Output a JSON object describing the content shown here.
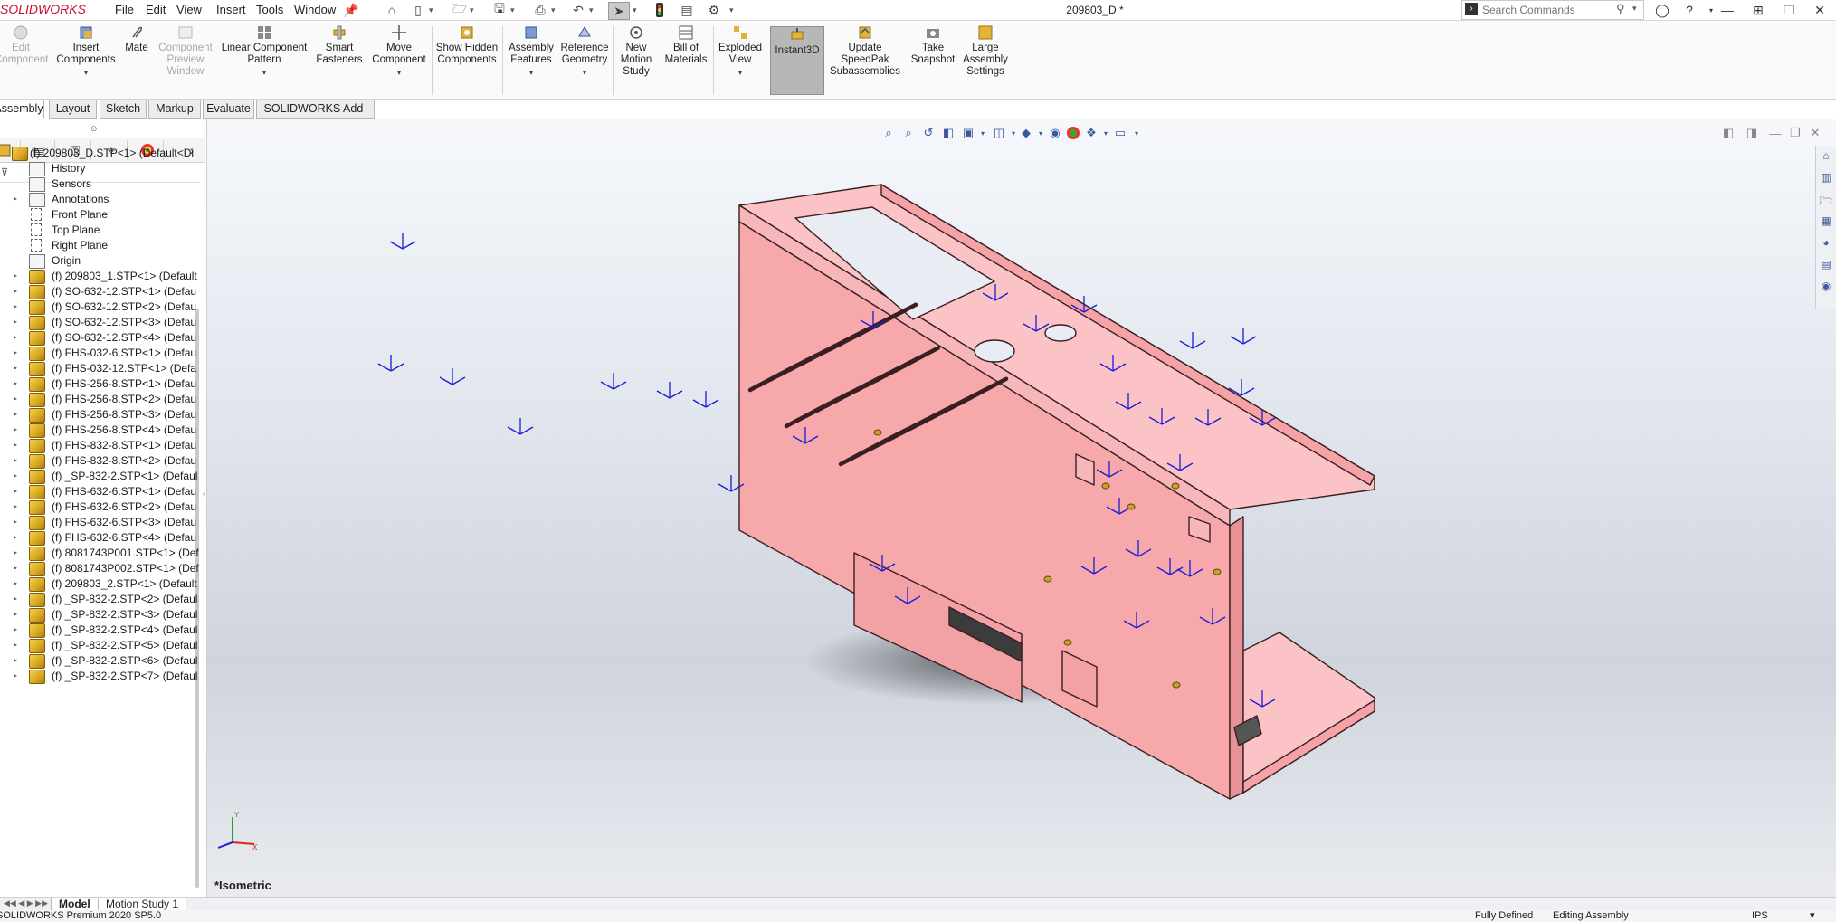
{
  "titlebar": {
    "logo_brand": "3S",
    "logo_text": "SOLIDWORKS",
    "menus": [
      "File",
      "Edit",
      "View",
      "Insert",
      "Tools",
      "Window"
    ],
    "document_title": "209803_D *",
    "search_placeholder": "Search Commands"
  },
  "toolbar": {
    "edit_component": "Edit Component",
    "insert_components": "Insert Components",
    "mate": "Mate",
    "component_preview": "Component Preview Window",
    "linear_pattern": "Linear Component Pattern",
    "smart_fasteners": "Smart Fasteners",
    "move_component": "Move Component",
    "show_hidden": "Show Hidden Components",
    "assembly_features": "Assembly Features",
    "reference_geometry": "Reference Geometry",
    "new_motion_study": "New Motion Study",
    "bill_of_materials": "Bill of Materials",
    "exploded_view": "Exploded View",
    "instant3d": "Instant3D",
    "update_speedpak": "Update SpeedPak Subassemblies",
    "take_snapshot": "Take Snapshot",
    "large_assembly": "Large Assembly Settings"
  },
  "tabs": [
    "Assembly",
    "Layout",
    "Sketch",
    "Markup",
    "Evaluate",
    "SOLIDWORKS Add-Ins"
  ],
  "feature_tree": {
    "root": "(f) 209803_D.STP<1> (Default<Di",
    "folders": [
      "History",
      "Sensors",
      "Annotations",
      "Front Plane",
      "Top Plane",
      "Right Plane",
      "Origin"
    ],
    "parts": [
      "(f) 209803_1.STP<1> (Default",
      "(f) SO-632-12.STP<1> (Defau",
      "(f) SO-632-12.STP<2> (Defau",
      "(f) SO-632-12.STP<3> (Defau",
      "(f) SO-632-12.STP<4> (Defau",
      "(f) FHS-032-6.STP<1> (Defau",
      "(f) FHS-032-12.STP<1> (Defa",
      "(f) FHS-256-8.STP<1> (Defau",
      "(f) FHS-256-8.STP<2> (Defau",
      "(f) FHS-256-8.STP<3> (Defau",
      "(f) FHS-256-8.STP<4> (Defau",
      "(f) FHS-832-8.STP<1> (Defau",
      "(f) FHS-832-8.STP<2> (Defau",
      "(f) _SP-832-2.STP<1> (Defaul",
      "(f) FHS-632-6.STP<1> (Defau",
      "(f) FHS-632-6.STP<2> (Defau",
      "(f) FHS-632-6.STP<3> (Defau",
      "(f) FHS-632-6.STP<4> (Defau",
      "(f) 8081743P001.STP<1> (Def",
      "(f) 8081743P002.STP<1> (Def",
      "(f) 209803_2.STP<1> (Default",
      "(f) _SP-832-2.STP<2> (Defaul",
      "(f) _SP-832-2.STP<3> (Defaul",
      "(f) _SP-832-2.STP<4> (Defaul",
      "(f) _SP-832-2.STP<5> (Defaul",
      "(f) _SP-832-2.STP<6> (Defaul",
      "(f) _SP-832-2.STP<7> (Defaul"
    ]
  },
  "viewport": {
    "view_name": "*Isometric",
    "model_color": "#f5a3a7",
    "background_top": "#f6f8fc",
    "background_bottom": "#cfd4dd"
  },
  "bottom_tabs": [
    "Model",
    "Motion Study 1"
  ],
  "statusbar": {
    "product": "SOLIDWORKS Premium 2020 SP5.0",
    "status": "Fully Defined",
    "mode": "Editing Assembly",
    "units": "IPS"
  },
  "colors": {
    "accent_red": "#c8102e",
    "triad_blue": "#1b1bd6"
  }
}
